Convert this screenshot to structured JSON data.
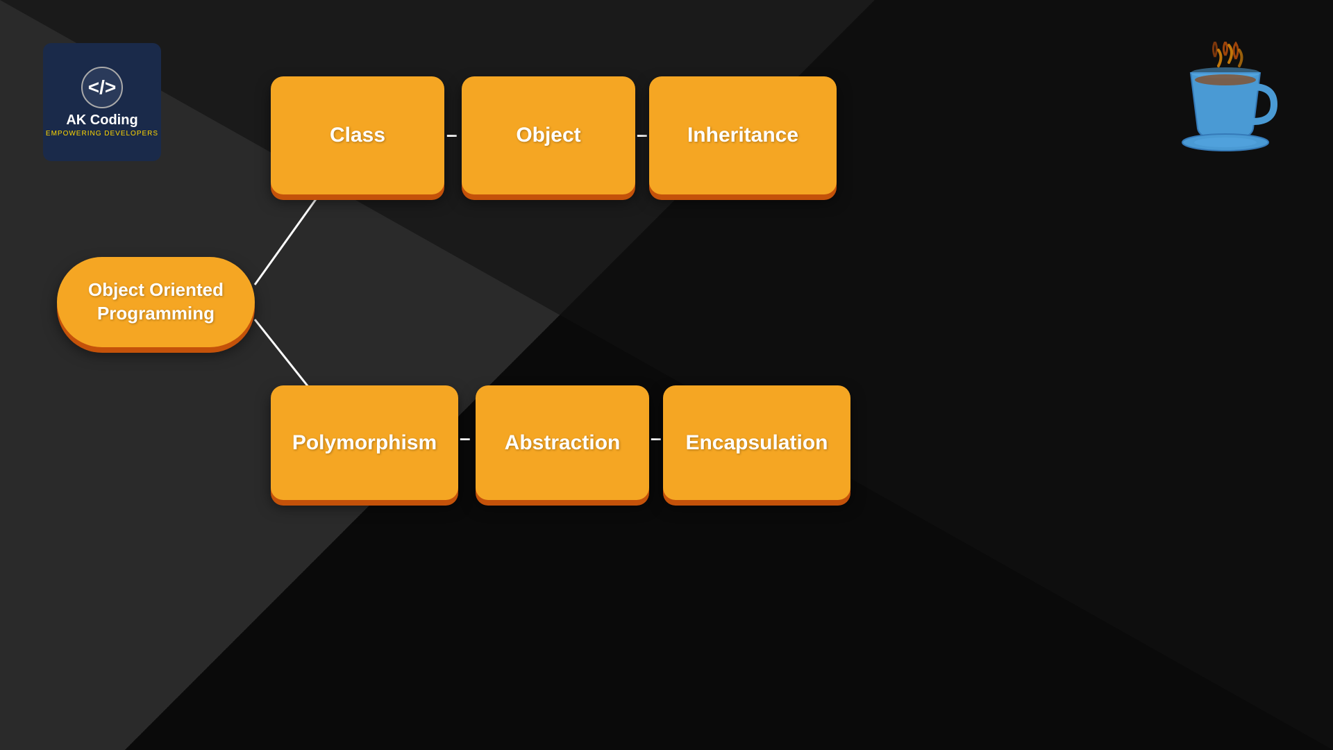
{
  "logo": {
    "code_symbol": "</>",
    "title": "AK Coding",
    "subtitle": "EMPOWERING DEVELOPERS"
  },
  "diagram": {
    "center_node": {
      "line1": "Object Oriented",
      "line2": "Programming"
    },
    "top_row": [
      {
        "label": "Class"
      },
      {
        "label": "Object"
      },
      {
        "label": "Inheritance"
      }
    ],
    "bottom_row": [
      {
        "label": "Polymorphism"
      },
      {
        "label": "Abstraction"
      },
      {
        "label": "Encapsulation"
      }
    ],
    "dash": "–"
  },
  "colors": {
    "box_fill": "#f5a623",
    "box_shadow": "#c4520a",
    "background_light": "#2a2a2a",
    "background_dark": "#0a0a0a",
    "logo_bg": "#1a2a4a"
  }
}
